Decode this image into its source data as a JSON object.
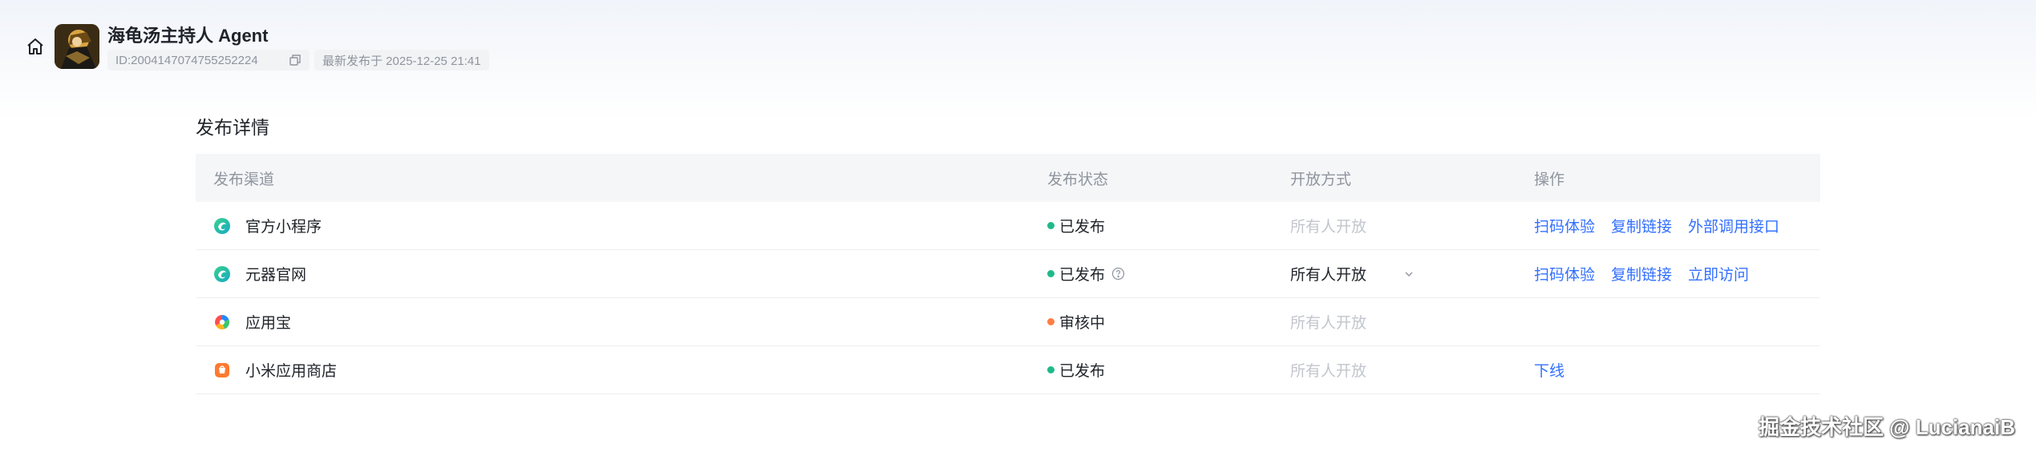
{
  "header": {
    "title": "海龟汤主持人 Agent",
    "id_text": "ID:2004147074755252224",
    "publish_time": "最新发布于 2025-12-25 21:41"
  },
  "section": {
    "title": "发布详情"
  },
  "table": {
    "columns": [
      "发布渠道",
      "发布状态",
      "开放方式",
      "操作"
    ],
    "rows": [
      {
        "channel": "官方小程序",
        "icon": "mini-program-icon",
        "status": "已发布",
        "status_color": "#1fba8a",
        "open_mode": "所有人开放",
        "open_mode_editable": false,
        "actions": [
          "扫码体验",
          "复制链接",
          "外部调用接口"
        ]
      },
      {
        "channel": "元器官网",
        "icon": "yuanqi-web-icon",
        "status": "已发布",
        "status_color": "#1fba8a",
        "open_mode": "所有人开放",
        "open_mode_editable": true,
        "actions": [
          "扫码体验",
          "复制链接",
          "立即访问"
        ]
      },
      {
        "channel": "应用宝",
        "icon": "app-store-icon",
        "status": "审核中",
        "status_color": "#ff7d45",
        "open_mode": "所有人开放",
        "open_mode_editable": false,
        "actions": []
      },
      {
        "channel": "小米应用商店",
        "icon": "xiaomi-store-icon",
        "status": "已发布",
        "status_color": "#1fba8a",
        "open_mode": "所有人开放",
        "open_mode_editable": false,
        "actions": [
          "下线"
        ]
      }
    ]
  },
  "watermark": "掘金技术社区 @ LucianaiB",
  "colors": {
    "accent": "#3370ff",
    "published": "#1fba8a",
    "reviewing": "#ff7d45"
  }
}
